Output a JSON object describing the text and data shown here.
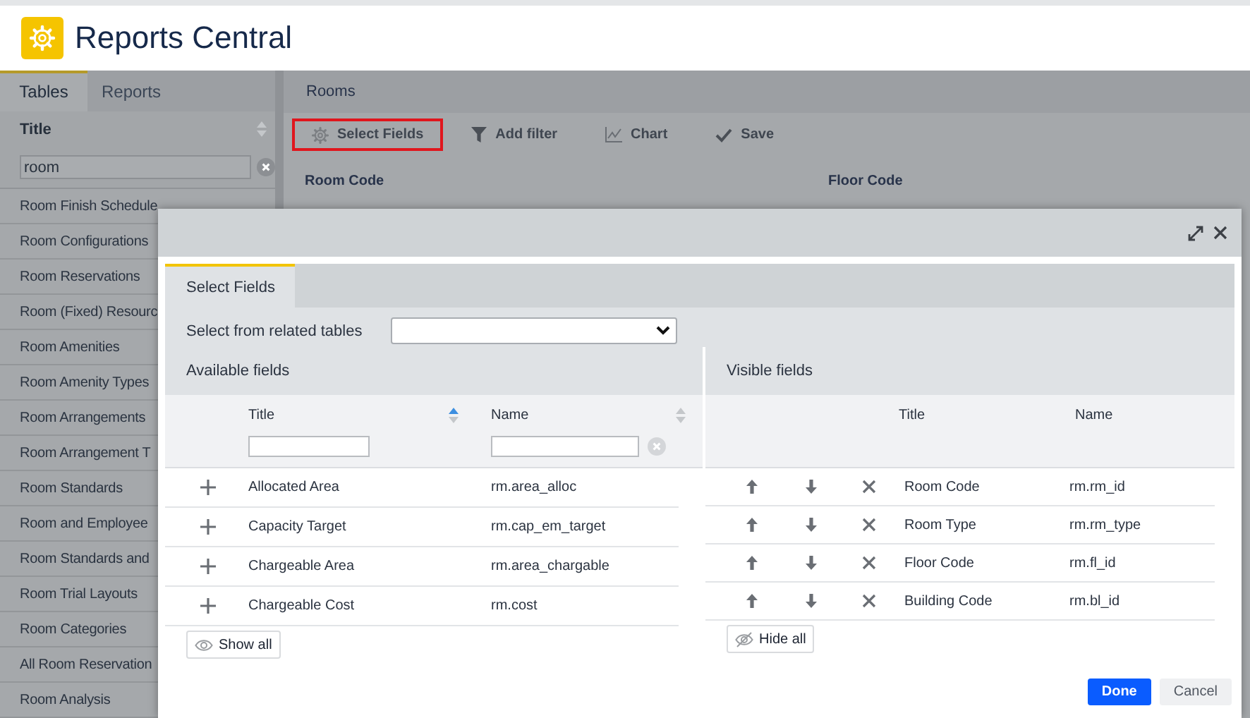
{
  "app": {
    "title": "Reports Central"
  },
  "sidebar": {
    "tabs": [
      {
        "label": "Tables",
        "selected": true
      },
      {
        "label": "Reports",
        "selected": false
      }
    ],
    "column": {
      "label": "Title",
      "sorted": false
    },
    "search": {
      "value": "room"
    },
    "items": [
      "Room Finish Schedule",
      "Room Configurations",
      "Room Reservations",
      "Room (Fixed) Resourc",
      "Room Amenities",
      "Room Amenity Types",
      "Room Arrangements",
      "Room Arrangement T",
      "Room Standards",
      "Room and Employee",
      "Room Standards and",
      "Room Trial Layouts",
      "Room Categories",
      "All Room Reservation",
      "Room Analysis"
    ]
  },
  "report": {
    "title": "Rooms",
    "toolbar": [
      {
        "label": "Select Fields",
        "highlighted": true
      },
      {
        "label": "Add filter",
        "highlighted": false
      },
      {
        "label": "Chart",
        "highlighted": false
      },
      {
        "label": "Save",
        "highlighted": false
      }
    ],
    "columns": [
      "Room Code",
      "Floor Code"
    ]
  },
  "dialog": {
    "tabs": [
      {
        "label": "Select Fields",
        "selected": true
      }
    ],
    "related_tables": {
      "label": "Select from related tables"
    },
    "available": {
      "title": "Available fields",
      "columns": [
        {
          "label": "Title",
          "sorted": true
        },
        {
          "label": "Name",
          "sorted": false
        }
      ],
      "rows": [
        {
          "title": "Allocated Area",
          "name": "rm.area_alloc"
        },
        {
          "title": "Capacity Target",
          "name": "rm.cap_em_target"
        },
        {
          "title": "Chargeable Area",
          "name": "rm.area_chargable"
        },
        {
          "title": "Chargeable Cost",
          "name": "rm.cost"
        }
      ],
      "button": "Show all"
    },
    "visible": {
      "title": "Visible fields",
      "columns": [
        {
          "label": "Title"
        },
        {
          "label": "Name"
        }
      ],
      "rows": [
        {
          "title": "Room Code",
          "name": "rm.rm_id"
        },
        {
          "title": "Room Type",
          "name": "rm.rm_type"
        },
        {
          "title": "Floor Code",
          "name": "rm.fl_id"
        },
        {
          "title": "Building Code",
          "name": "rm.bl_id"
        }
      ],
      "button": "Hide all"
    },
    "buttons": [
      {
        "label": "Done",
        "kind": "primary"
      },
      {
        "label": "Cancel",
        "kind": "secondary"
      }
    ]
  }
}
